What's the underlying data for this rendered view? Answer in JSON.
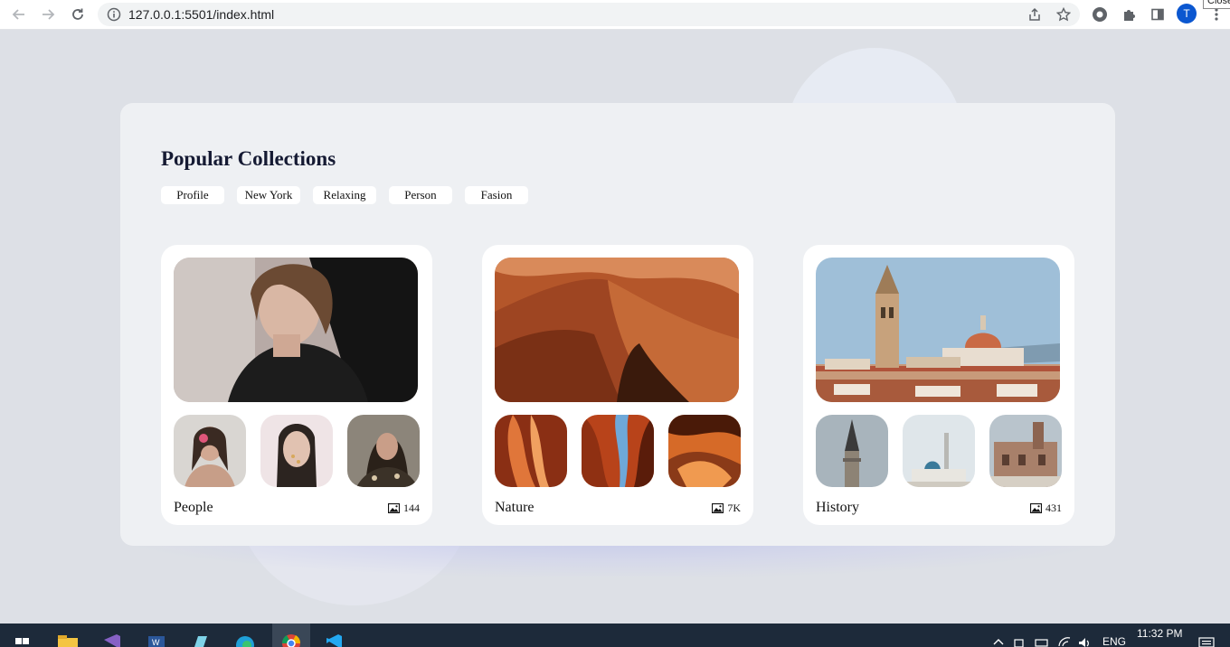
{
  "browser": {
    "url": "127.0.0.1:5501/index.html",
    "profile_initial": "T",
    "close_tooltip": "Close",
    "accent": "#0b57d0"
  },
  "page": {
    "title": "Popular Collections",
    "tags": [
      "Profile",
      "New York",
      "Relaxing",
      "Person",
      "Fasion"
    ],
    "cards": [
      {
        "label": "People",
        "count": "144",
        "icon": "image-icon"
      },
      {
        "label": "Nature",
        "count": "7K",
        "icon": "image-icon"
      },
      {
        "label": "History",
        "count": "431",
        "icon": "image-icon"
      }
    ]
  },
  "taskbar": {
    "language": "ENG",
    "time": "11:32 PM",
    "apps": [
      "file-explorer-icon",
      "visual-studio-icon",
      "word-icon",
      "notepad-icon",
      "edge-icon",
      "chrome-icon",
      "vscode-icon"
    ]
  }
}
